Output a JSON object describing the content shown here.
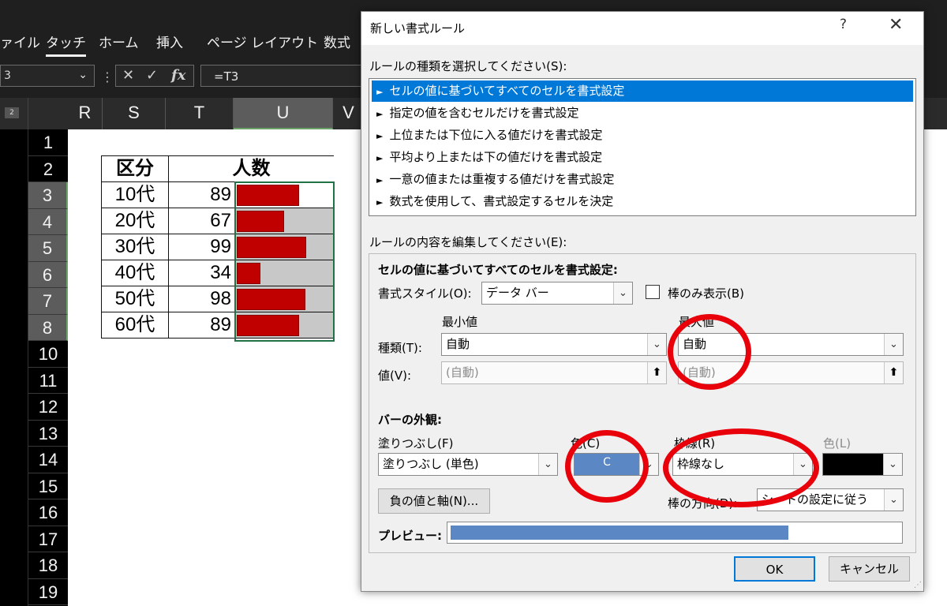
{
  "excel": {
    "ribbon_tabs": [
      {
        "label": "ァイル",
        "active": false
      },
      {
        "label": "タッチ",
        "active": true
      },
      {
        "label": "ホーム",
        "active": false
      },
      {
        "label": "挿入",
        "active": false
      },
      {
        "label": "ページ レイアウト",
        "active": false
      },
      {
        "label": "数式",
        "active": false
      }
    ],
    "namebox_value": "3",
    "formula_value": "=T3",
    "fx_label": "fx",
    "outline_level": "2",
    "columns": [
      "R",
      "S",
      "T",
      "U",
      "V"
    ],
    "selected_column": "U",
    "rows": [
      "1",
      "2",
      "3",
      "4",
      "5",
      "6",
      "7",
      "8",
      "10",
      "11",
      "12",
      "13",
      "14",
      "15",
      "16",
      "17",
      "18",
      "19"
    ],
    "selected_rows": [
      "3",
      "4",
      "5",
      "6",
      "7",
      "8"
    ],
    "table": {
      "header_left": "区分",
      "header_right": "人数",
      "rows": [
        {
          "label": "10代",
          "value": 89
        },
        {
          "label": "20代",
          "value": 67
        },
        {
          "label": "30代",
          "value": 99
        },
        {
          "label": "40代",
          "value": 34
        },
        {
          "label": "50代",
          "value": 98
        },
        {
          "label": "60代",
          "value": 89
        }
      ],
      "databar_color": "#c00000",
      "databar_max": 135
    }
  },
  "dialog": {
    "title": "新しい書式ルール",
    "help": "?",
    "close": "✕",
    "rule_type_label": "ルールの種類を選択してください(S):",
    "rule_types": [
      {
        "label": "セルの値に基づいてすべてのセルを書式設定",
        "selected": true
      },
      {
        "label": "指定の値を含むセルだけを書式設定",
        "selected": false
      },
      {
        "label": "上位または下位に入る値だけを書式設定",
        "selected": false
      },
      {
        "label": "平均より上または下の値だけを書式設定",
        "selected": false
      },
      {
        "label": "一意の値または重複する値だけを書式設定",
        "selected": false
      },
      {
        "label": "数式を使用して、書式設定するセルを決定",
        "selected": false
      }
    ],
    "edit_label": "ルールの内容を編集してください(E):",
    "edit_heading": "セルの値に基づいてすべてのセルを書式設定:",
    "format_style_label": "書式スタイル(O):",
    "format_style_value": "データ バー",
    "bar_only_label": "棒のみ表示(B)",
    "bar_only_checked": false,
    "min_label": "最小値",
    "max_label": "最大値",
    "type_label": "種類(T):",
    "min_type": "自動",
    "max_type": "自動",
    "value_label": "値(V):",
    "min_value": "(自動)",
    "max_value": "(自動)",
    "bar_appearance_label": "バーの外観:",
    "fill_label": "塗りつぶし(F)",
    "fill_value": "塗りつぶし (単色)",
    "color_label": "色(C)",
    "fill_color": "#5b87c5",
    "fill_color_text": "C",
    "border_label": "枠線(R)",
    "border_value": "枠線なし",
    "border_color_label": "色(L)",
    "border_color": "#000000",
    "negative_button": "負の値と軸(N)...",
    "direction_label": "棒の方向(D):",
    "direction_value": "シートの設定に従う",
    "preview_label": "プレビュー:",
    "preview_fill": 0.75,
    "ok": "OK",
    "cancel": "キャンセル",
    "annotation_color": "#e8000b"
  }
}
